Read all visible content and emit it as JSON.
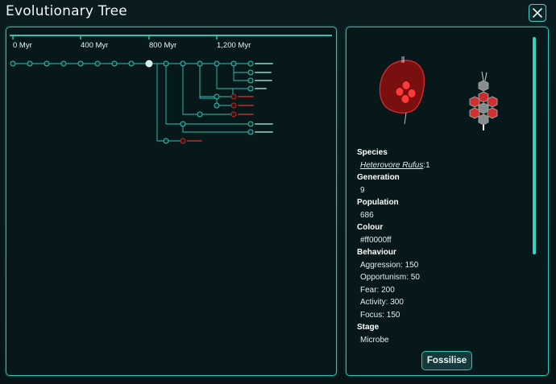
{
  "window": {
    "title": "Evolutionary Tree"
  },
  "timeline": {
    "ticks": [
      "0 Myr",
      "400 Myr",
      "800 Myr",
      "1,200 Myr"
    ]
  },
  "tree": {
    "node_count": 33,
    "selected_generation": 9
  },
  "details": {
    "species_label": "Species",
    "species_name": "Heterovore Rufus",
    "species_suffix": ":1",
    "generation_label": "Generation",
    "generation_value": "9",
    "population_label": "Population",
    "population_value": "686",
    "colour_label": "Colour",
    "colour_value": "#ff0000ff",
    "behaviour_label": "Behaviour",
    "behaviour": [
      "Aggression: 150",
      "Opportunism: 50",
      "Fear: 200",
      "Activity: 300",
      "Focus: 150"
    ],
    "stage_label": "Stage",
    "stage_value": "Microbe"
  },
  "fossilise_button": "Fossilise",
  "colors": {
    "accent": "#2ec4b6",
    "background": "#071416",
    "extinct": "#c0282a",
    "organism": "#b81c1c"
  }
}
